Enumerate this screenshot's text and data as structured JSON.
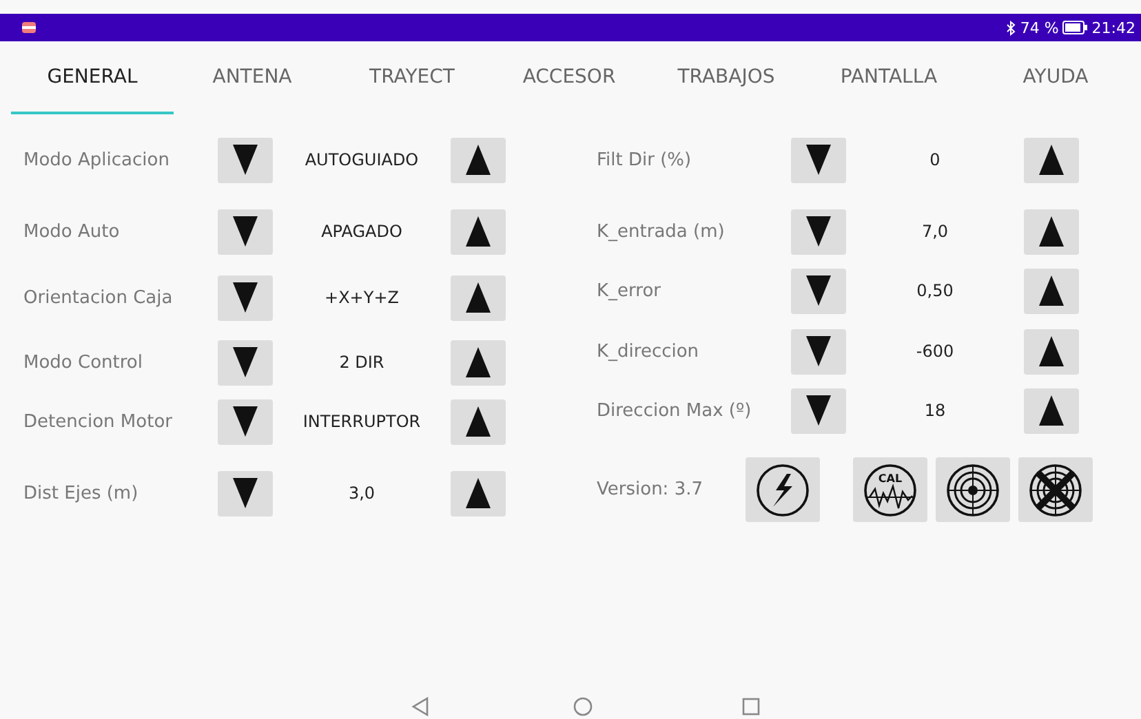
{
  "status_bar": {
    "battery": "74 %",
    "time": "21:42"
  },
  "tabs": [
    {
      "label": "GENERAL",
      "selected": true
    },
    {
      "label": "ANTENA",
      "selected": false
    },
    {
      "label": "TRAYECT",
      "selected": false
    },
    {
      "label": "ACCESOR",
      "selected": false
    },
    {
      "label": "TRABAJOS",
      "selected": false
    },
    {
      "label": "PANTALLA",
      "selected": false
    },
    {
      "label": "AYUDA",
      "selected": false
    }
  ],
  "left_settings": [
    {
      "label": "Modo Aplicacion",
      "value": "AUTOGUIADO"
    },
    {
      "label": "Modo Auto",
      "value": "APAGADO"
    },
    {
      "label": "Orientacion Caja",
      "value": "+X+Y+Z"
    },
    {
      "label": "Modo Control",
      "value": "2 DIR"
    },
    {
      "label": "Detencion Motor",
      "value": "INTERRUPTOR"
    },
    {
      "label": "Dist Ejes (m)",
      "value": "3,0"
    }
  ],
  "right_settings": [
    {
      "label": "Filt Dir (%)",
      "value": "0"
    },
    {
      "label": "K_entrada (m)",
      "value": "7,0"
    },
    {
      "label": "K_error",
      "value": "0,50"
    },
    {
      "label": "K_direccion",
      "value": "-600"
    },
    {
      "label": "Direccion Max (º)",
      "value": "18"
    }
  ],
  "version": "Version: 3.7",
  "tool_buttons": [
    {
      "kind": "lightning"
    },
    {
      "kind": "calibration",
      "label": "CAL"
    },
    {
      "kind": "target"
    },
    {
      "kind": "target-crossed"
    }
  ]
}
